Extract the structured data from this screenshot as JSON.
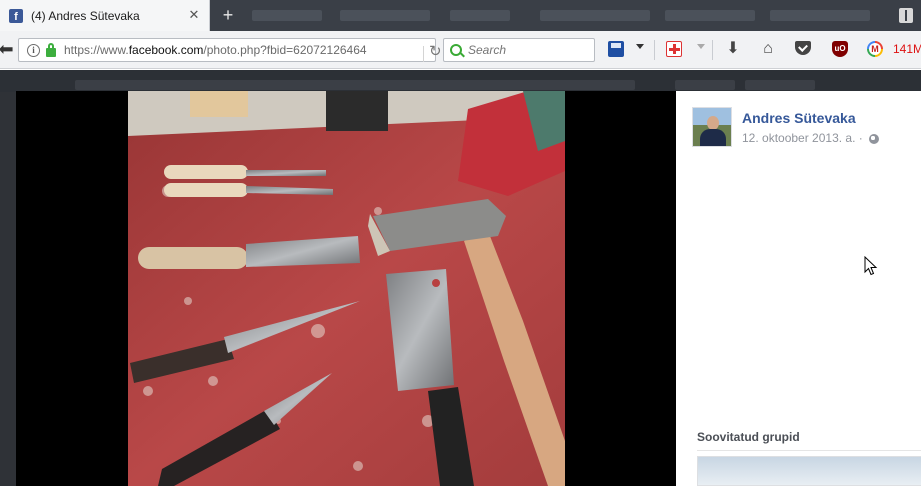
{
  "browser": {
    "tab_title": "(4) Andres Sütevaka",
    "tab_favicon_letter": "f",
    "new_tab_label": "+",
    "url_prefix": "https://www.",
    "url_domain": "facebook.com",
    "url_path": "/photo.php?fbid=62072126464",
    "search_placeholder": "Search",
    "memory_label": "141M",
    "icons": [
      "back-arrow-icon",
      "info-icon",
      "lock-icon",
      "reload-icon",
      "search-icon",
      "save-icon",
      "first-aid-icon",
      "download-icon",
      "home-icon",
      "pocket-icon",
      "ublock-icon",
      "gmail-checker-icon",
      "reader-view-icon"
    ]
  },
  "post": {
    "author": "Andres Sütevaka",
    "date": "12. oktoober 2013. a. ·"
  },
  "sidebar": {
    "recommended_title": "Soovitatud grupid"
  },
  "colors": {
    "facebook_blue": "#3b5998",
    "author_link": "#365899",
    "muted_text": "#90949c",
    "tab_strip": "#3a3f47",
    "memory_red": "#dd1111"
  }
}
